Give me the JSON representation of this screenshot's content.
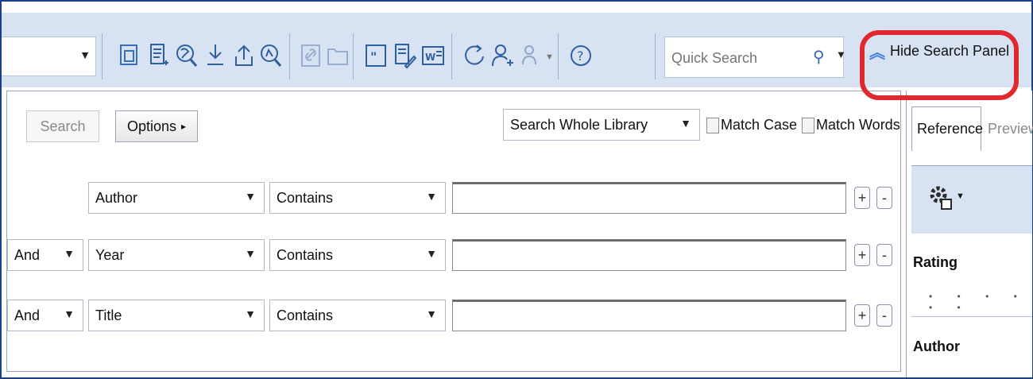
{
  "toolbar": {
    "icons": [
      "dropdown-arrow",
      "copy-references-icon",
      "new-reference-icon",
      "online-search-icon",
      "import-icon",
      "export-icon",
      "find-full-text-icon",
      "open-link-icon",
      "open-file-icon",
      "insert-citation-icon",
      "format-bibliography-icon",
      "return-to-word-icon",
      "sync-icon",
      "share-library-icon",
      "share-group-icon",
      "help-icon"
    ],
    "quick_search_placeholder": "Quick Search",
    "hide_panel_label": "Hide Search Panel"
  },
  "search_panel": {
    "search_button": "Search",
    "options_button": "Options",
    "options_arrow": "▸",
    "scope_select": "Search Whole Library",
    "match_case": "Match Case",
    "match_words": "Match Words",
    "rows": [
      {
        "bool": "",
        "field": "Author",
        "operator": "Contains",
        "value": ""
      },
      {
        "bool": "And",
        "field": "Year",
        "operator": "Contains",
        "value": ""
      },
      {
        "bool": "And",
        "field": "Title",
        "operator": "Contains",
        "value": ""
      }
    ],
    "plus": "+",
    "minus": "-"
  },
  "right_panel": {
    "tab_reference": "Reference",
    "tab_preview": "Preview",
    "rating_label": "Rating",
    "rating_dots": "• • • • • •",
    "author_label": "Author"
  },
  "colors": {
    "toolbar_bg": "#d7e3f3",
    "frame_border": "#1a3f8f",
    "highlight_red": "#e0282f",
    "accent_blue": "#3d7fd8"
  }
}
